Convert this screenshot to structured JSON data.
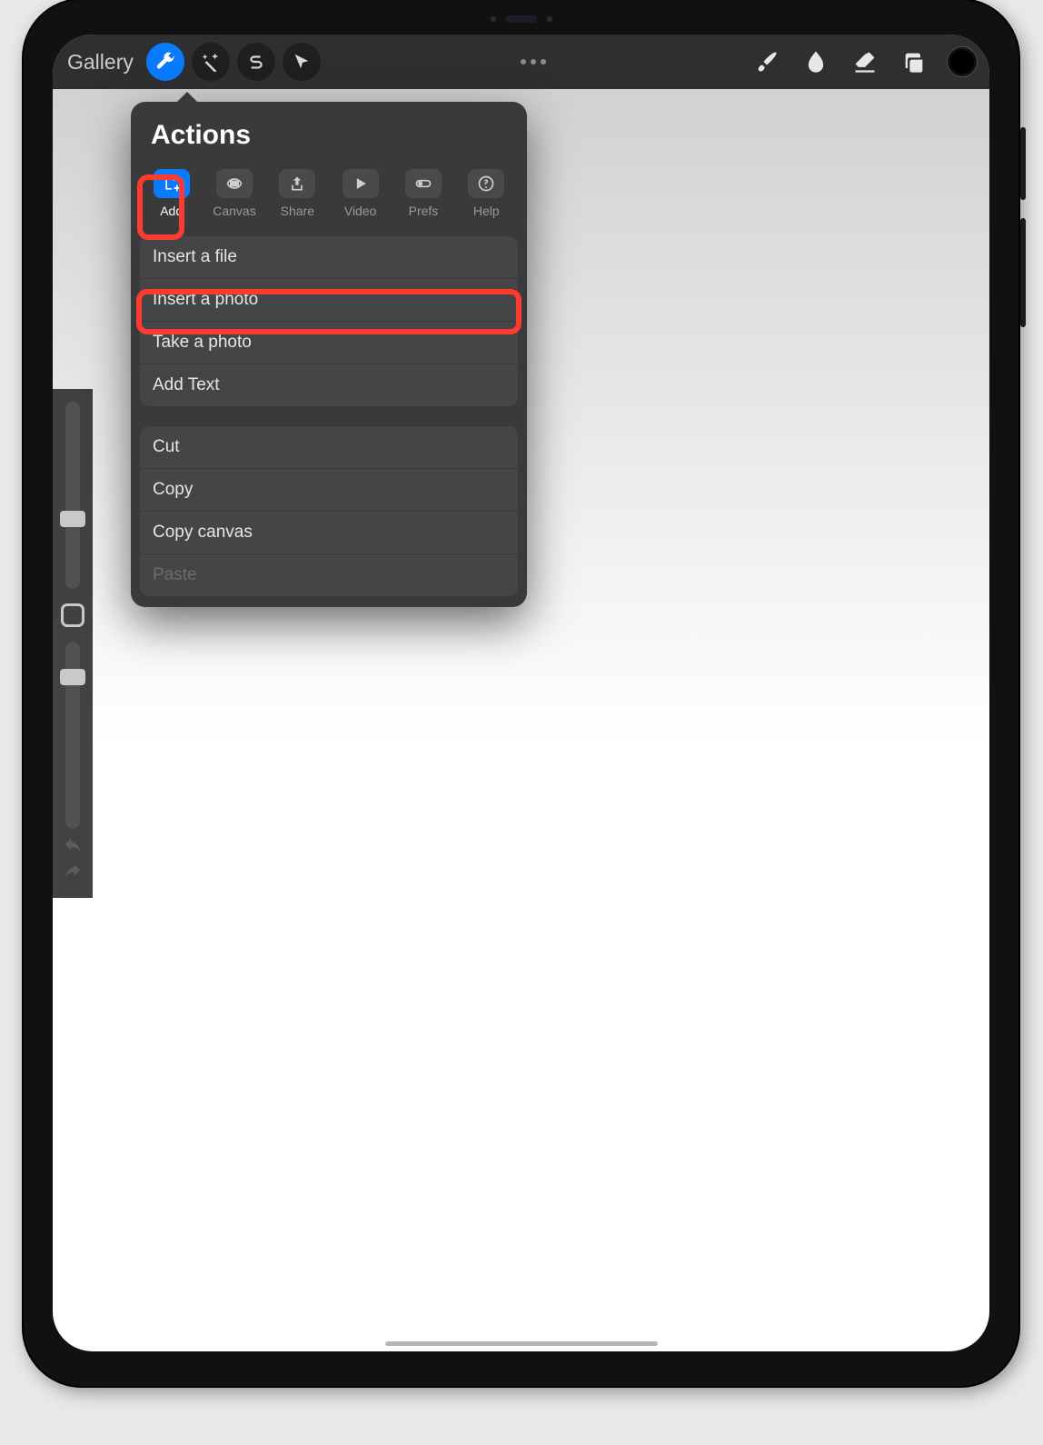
{
  "toolbar": {
    "gallery_label": "Gallery"
  },
  "popover": {
    "title": "Actions",
    "tabs": [
      {
        "label": "Add"
      },
      {
        "label": "Canvas"
      },
      {
        "label": "Share"
      },
      {
        "label": "Video"
      },
      {
        "label": "Prefs"
      },
      {
        "label": "Help"
      }
    ],
    "group1": [
      "Insert a file",
      "Insert a photo",
      "Take a photo",
      "Add Text"
    ],
    "group2": [
      "Cut",
      "Copy",
      "Copy canvas",
      "Paste"
    ]
  }
}
